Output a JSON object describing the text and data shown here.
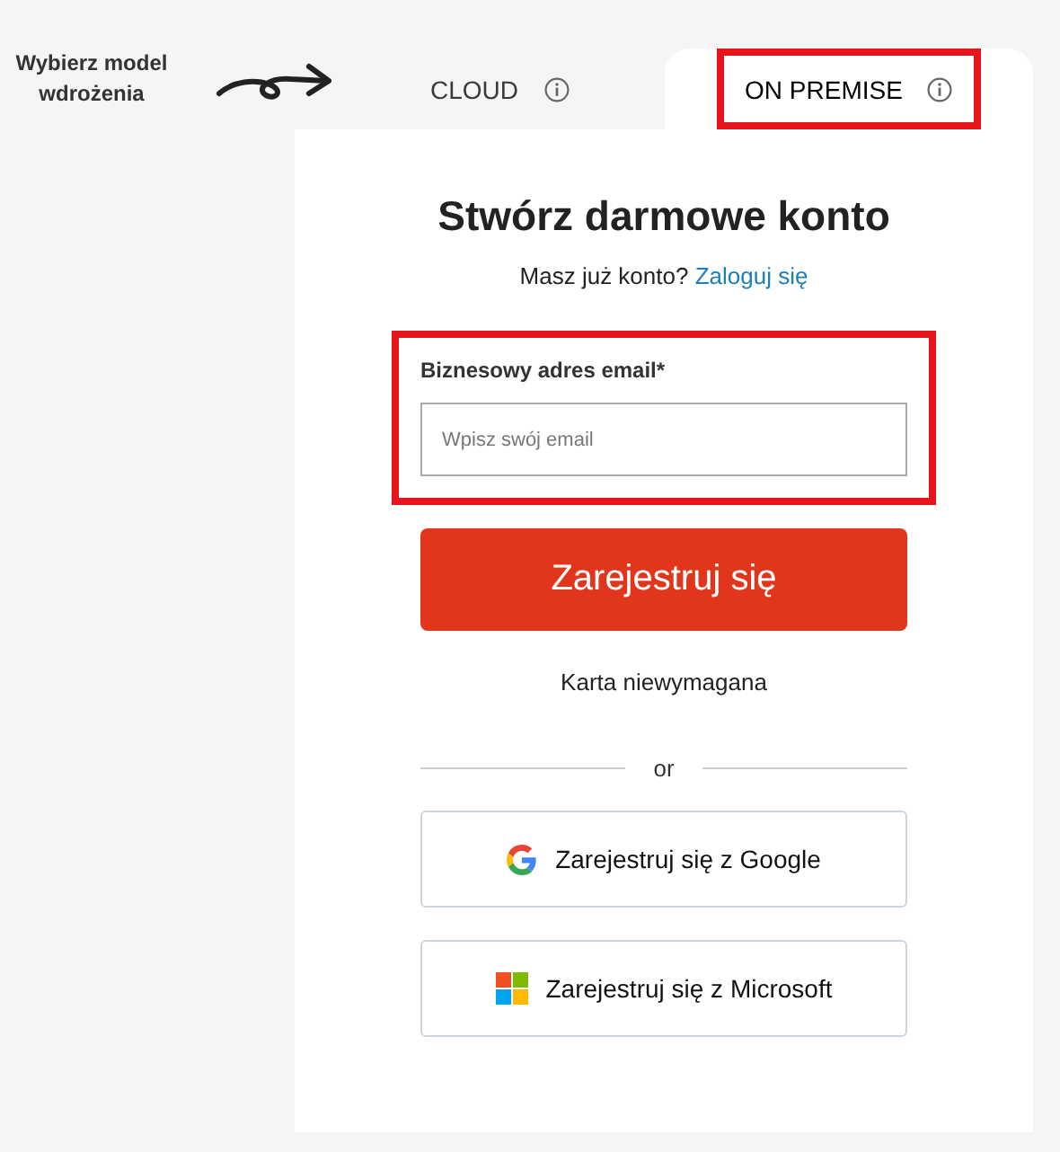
{
  "hint": {
    "text": "Wybierz model wdrożenia"
  },
  "tabs": [
    {
      "label": "CLOUD",
      "selected": false,
      "highlighted": false
    },
    {
      "label": "ON PREMISE",
      "selected": true,
      "highlighted": true
    }
  ],
  "form": {
    "title": "Stwórz darmowe konto",
    "login_prompt": "Masz już konto?",
    "login_link": "Zaloguj się",
    "email": {
      "label": "Biznesowy adres email*",
      "placeholder": "Wpisz swój email",
      "highlighted": true
    },
    "submit": "Zarejestruj się",
    "note": "Karta niewymagana",
    "divider": "or",
    "social": [
      {
        "kind": "google",
        "label": "Zarejestruj się z Google"
      },
      {
        "kind": "microsoft",
        "label": "Zarejestruj się z Microsoft"
      }
    ]
  }
}
